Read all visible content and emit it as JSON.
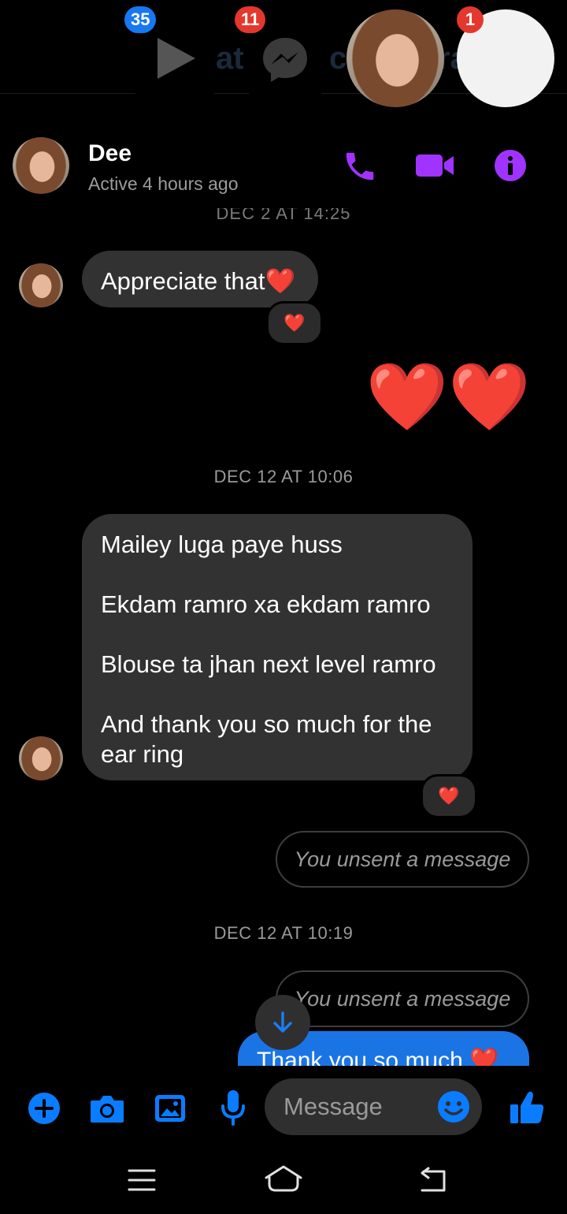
{
  "colors": {
    "accent_purple": "#a033ff",
    "messenger_blue": "#0a7cff",
    "badge_blue": "#1877f2",
    "badge_red": "#e4372d"
  },
  "chat_heads": {
    "video_badge": "35",
    "messenger_badge": "11",
    "avatar_badge": "1",
    "peek_text_1": "at",
    "peek_text_2": "c",
    "peek_text_3": "ra"
  },
  "header": {
    "contact_name": "Dee",
    "status": "Active 4 hours ago",
    "top_date": "DEC 2 AT 14:25",
    "icons": [
      "phone-icon",
      "video-call-icon",
      "info-icon"
    ]
  },
  "messages": {
    "m1_text": "Appreciate that",
    "m1_heart": "❤️",
    "m1_reaction": "❤️",
    "m2_hearts": "❤️❤️",
    "date2": "DEC 12 AT 10:06",
    "m3_lines": [
      "Mailey luga paye huss",
      "Ekdam ramro xa ekdam ramro",
      "Blouse ta jhan next level ramro",
      "And thank you so much for the ear ring"
    ],
    "m3_reaction": "❤️",
    "unsent_1": "You unsent a message",
    "date3": "DEC 12 AT 10:19",
    "unsent_2": "You unsent a message",
    "last_out": "Thank you so much ❤️"
  },
  "composer": {
    "placeholder": "Message",
    "icons": [
      "plus-icon",
      "camera-icon",
      "gallery-icon",
      "microphone-icon",
      "emoji-icon",
      "thumbs-up-icon"
    ]
  },
  "navbar": {
    "icons": [
      "recent-apps-icon",
      "home-icon",
      "back-icon"
    ]
  }
}
